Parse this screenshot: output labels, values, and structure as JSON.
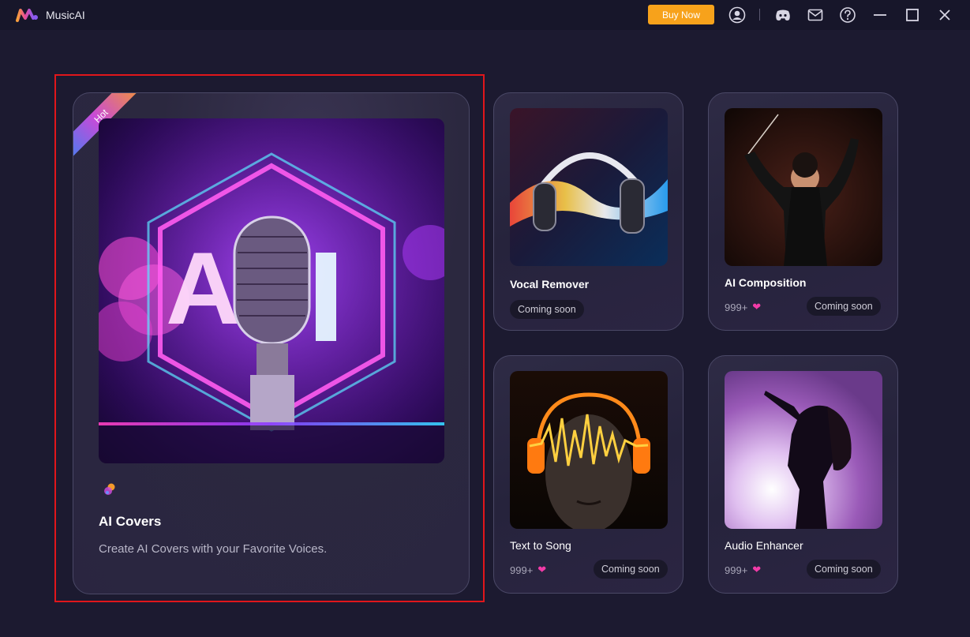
{
  "app": {
    "name": "MusicAI",
    "buy_label": "Buy Now",
    "icons": [
      "user-icon",
      "discord-icon",
      "mail-icon",
      "help-icon",
      "minimize-icon",
      "maximize-icon",
      "close-icon"
    ]
  },
  "featured": {
    "badge": "Hot",
    "image_text": "AI",
    "title": "AI Covers",
    "description": "Create AI Covers with your Favorite Voices."
  },
  "cards": [
    {
      "title": "Vocal Remover",
      "count": "",
      "status": "Coming soon"
    },
    {
      "title": "AI Composition",
      "count": "999+",
      "status": "Coming soon"
    },
    {
      "title": "Text to Song",
      "count": "999+",
      "status": "Coming soon"
    },
    {
      "title": "Audio Enhancer",
      "count": "999+",
      "status": "Coming soon"
    }
  ],
  "colors": {
    "background": "#1c1a30",
    "titlebar": "#17162a",
    "accent": "#f7a21b",
    "heart": "#f23ba8",
    "highlight": "#e0161b"
  }
}
